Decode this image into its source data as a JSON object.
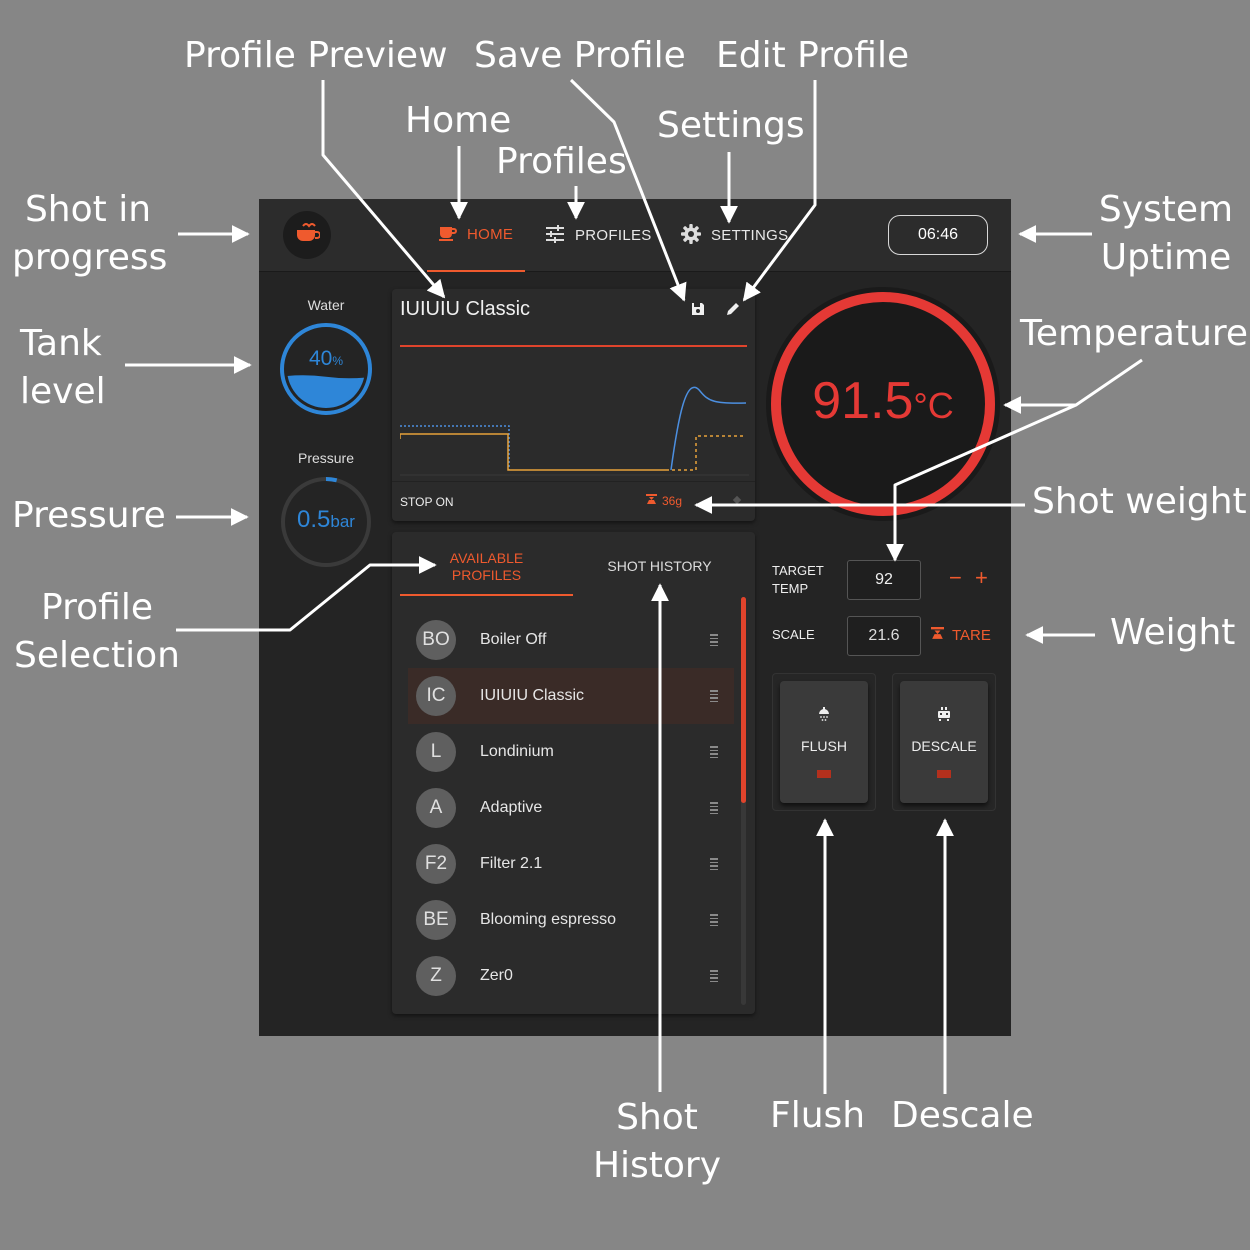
{
  "header": {
    "tabs": [
      {
        "label": "HOME",
        "active": true
      },
      {
        "label": "PROFILES",
        "active": false
      },
      {
        "label": "SETTINGS",
        "active": false
      }
    ],
    "uptime": "06:46"
  },
  "gauges": {
    "water": {
      "label": "Water",
      "value": "40",
      "unit": "%",
      "level": 0.4
    },
    "pressure": {
      "label": "Pressure",
      "value": "0.5",
      "unit": "bar",
      "level": 0.04
    }
  },
  "preview": {
    "title": "IUIUIU Classic",
    "stop_label": "STOP ON",
    "stop_weight": "36g"
  },
  "temperature": {
    "value": "91.5",
    "unit": "°C"
  },
  "profile_list": {
    "tabs": [
      {
        "label": "AVAILABLE PROFILES",
        "active": true
      },
      {
        "label": "SHOT HISTORY",
        "active": false
      }
    ],
    "items": [
      {
        "initials": "BO",
        "name": "Boiler Off",
        "selected": false
      },
      {
        "initials": "IC",
        "name": "IUIUIU Classic",
        "selected": true
      },
      {
        "initials": "L",
        "name": "Londinium",
        "selected": false
      },
      {
        "initials": "A",
        "name": "Adaptive",
        "selected": false
      },
      {
        "initials": "F2",
        "name": "Filter 2.1",
        "selected": false
      },
      {
        "initials": "BE",
        "name": "Blooming espresso",
        "selected": false
      },
      {
        "initials": "Z",
        "name": "Zer0",
        "selected": false
      }
    ]
  },
  "controls": {
    "target_temp_label": "TARGET TEMP",
    "target_temp_value": "92",
    "minus": "−",
    "plus": "+",
    "scale_label": "SCALE",
    "scale_value": "21.6",
    "tare_label": "TARE",
    "flush_label": "FLUSH",
    "descale_label": "DESCALE"
  },
  "callouts": {
    "profile_preview": "Profile Preview",
    "save_profile": "Save Profile",
    "edit_profile": "Edit Profile",
    "home": "Home",
    "profiles": "Profiles",
    "settings": "Settings",
    "shot_in_progress_1": "Shot in",
    "shot_in_progress_2": "progress",
    "system_uptime_1": "System",
    "system_uptime_2": "Uptime",
    "tank_level_1": "Tank",
    "tank_level_2": "level",
    "temperature": "Temperature",
    "pressure": "Pressure",
    "shot_weight": "Shot weight",
    "profile_selection_1": "Profile",
    "profile_selection_2": "Selection",
    "weight": "Weight",
    "shot_history_1": "Shot",
    "shot_history_2": "History",
    "flush": "Flush",
    "descale": "Descale"
  },
  "colors": {
    "accent": "#ef5a2e",
    "temperature": "#e53935",
    "water": "#2e86d8",
    "background": "#242424",
    "annotation_bg": "#868686"
  }
}
